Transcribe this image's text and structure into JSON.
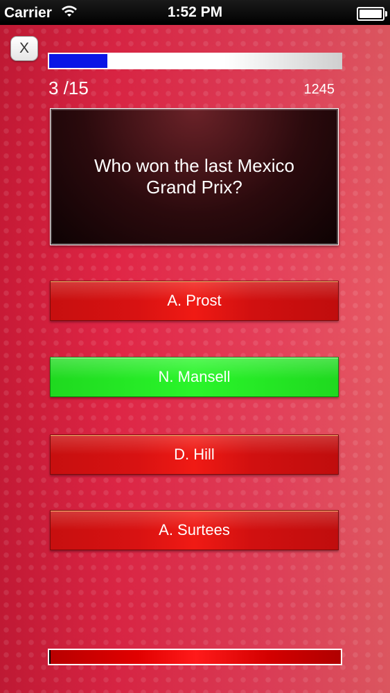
{
  "status_bar": {
    "carrier": "Carrier",
    "time": "1:52 PM",
    "wifi_icon": "wifi-icon",
    "battery_icon": "battery-icon"
  },
  "quiz": {
    "close_label": "X",
    "progress_fraction": 0.2,
    "question_number": "3 /15",
    "score": "1245",
    "question": "Who won the last Mexico Grand Prix?",
    "answers": [
      {
        "label": "A. Prost",
        "state": "default"
      },
      {
        "label": "N. Mansell",
        "state": "correct"
      },
      {
        "label": "D. Hill",
        "state": "default"
      },
      {
        "label": "A. Surtees",
        "state": "default"
      }
    ],
    "timer_fraction": 1.0
  },
  "colors": {
    "background": "#e12646",
    "progress_fill": "#0a16e6",
    "answer_default": "#d81212",
    "answer_correct": "#2af52a",
    "timer_fill": "#e10000"
  }
}
